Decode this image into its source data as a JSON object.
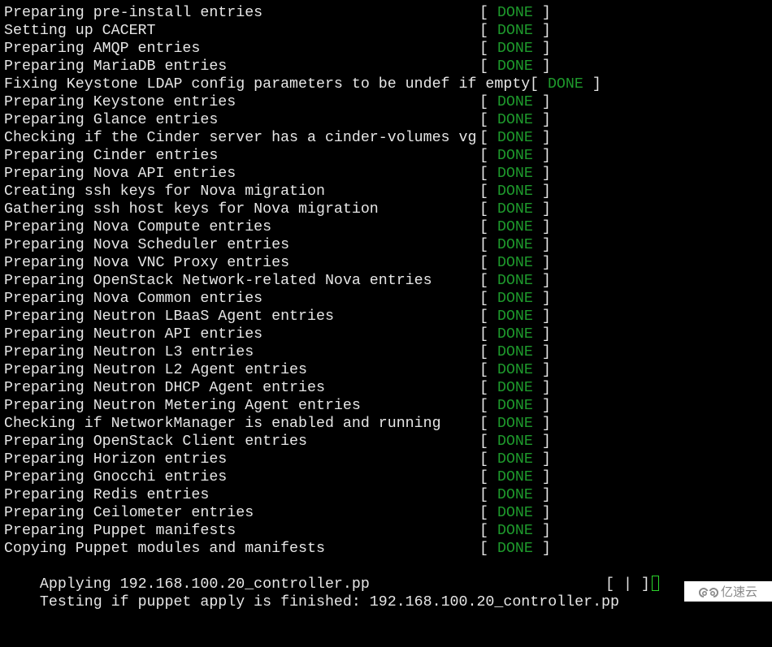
{
  "terminal": {
    "done_label": "DONE",
    "colors": {
      "text": "#e6e6e6",
      "done": "#1e9a2c",
      "background": "#000000",
      "cursor": "#2bd42b"
    },
    "lines": [
      {
        "text": "Preparing pre-install entries",
        "status": "DONE"
      },
      {
        "text": "Setting up CACERT",
        "status": "DONE"
      },
      {
        "text": "Preparing AMQP entries",
        "status": "DONE"
      },
      {
        "text": "Preparing MariaDB entries",
        "status": "DONE"
      },
      {
        "text": "Fixing Keystone LDAP config parameters to be undef if empty",
        "status": "DONE",
        "tight": true
      },
      {
        "text": "Preparing Keystone entries",
        "status": "DONE"
      },
      {
        "text": "Preparing Glance entries",
        "status": "DONE"
      },
      {
        "text": "Checking if the Cinder server has a cinder-volumes vg",
        "status": "DONE"
      },
      {
        "text": "Preparing Cinder entries",
        "status": "DONE"
      },
      {
        "text": "Preparing Nova API entries",
        "status": "DONE"
      },
      {
        "text": "Creating ssh keys for Nova migration",
        "status": "DONE"
      },
      {
        "text": "Gathering ssh host keys for Nova migration",
        "status": "DONE"
      },
      {
        "text": "Preparing Nova Compute entries",
        "status": "DONE"
      },
      {
        "text": "Preparing Nova Scheduler entries",
        "status": "DONE"
      },
      {
        "text": "Preparing Nova VNC Proxy entries",
        "status": "DONE"
      },
      {
        "text": "Preparing OpenStack Network-related Nova entries",
        "status": "DONE"
      },
      {
        "text": "Preparing Nova Common entries",
        "status": "DONE"
      },
      {
        "text": "Preparing Neutron LBaaS Agent entries",
        "status": "DONE"
      },
      {
        "text": "Preparing Neutron API entries",
        "status": "DONE"
      },
      {
        "text": "Preparing Neutron L3 entries",
        "status": "DONE"
      },
      {
        "text": "Preparing Neutron L2 Agent entries",
        "status": "DONE"
      },
      {
        "text": "Preparing Neutron DHCP Agent entries",
        "status": "DONE"
      },
      {
        "text": "Preparing Neutron Metering Agent entries",
        "status": "DONE"
      },
      {
        "text": "Checking if NetworkManager is enabled and running",
        "status": "DONE"
      },
      {
        "text": "Preparing OpenStack Client entries",
        "status": "DONE"
      },
      {
        "text": "Preparing Horizon entries",
        "status": "DONE"
      },
      {
        "text": "Preparing Gnocchi entries",
        "status": "DONE"
      },
      {
        "text": "Preparing Redis entries",
        "status": "DONE"
      },
      {
        "text": "Preparing Ceilometer entries",
        "status": "DONE"
      },
      {
        "text": "Preparing Puppet manifests",
        "status": "DONE"
      },
      {
        "text": "Copying Puppet modules and manifests",
        "status": "DONE"
      }
    ],
    "applying_line": "Applying 192.168.100.20_controller.pp",
    "testing_line": "Testing if puppet apply is finished: 192.168.100.20_controller.pp",
    "spinner": "[ | ]"
  },
  "watermark": {
    "icon": "cloud-logo-icon",
    "text": "亿速云"
  }
}
